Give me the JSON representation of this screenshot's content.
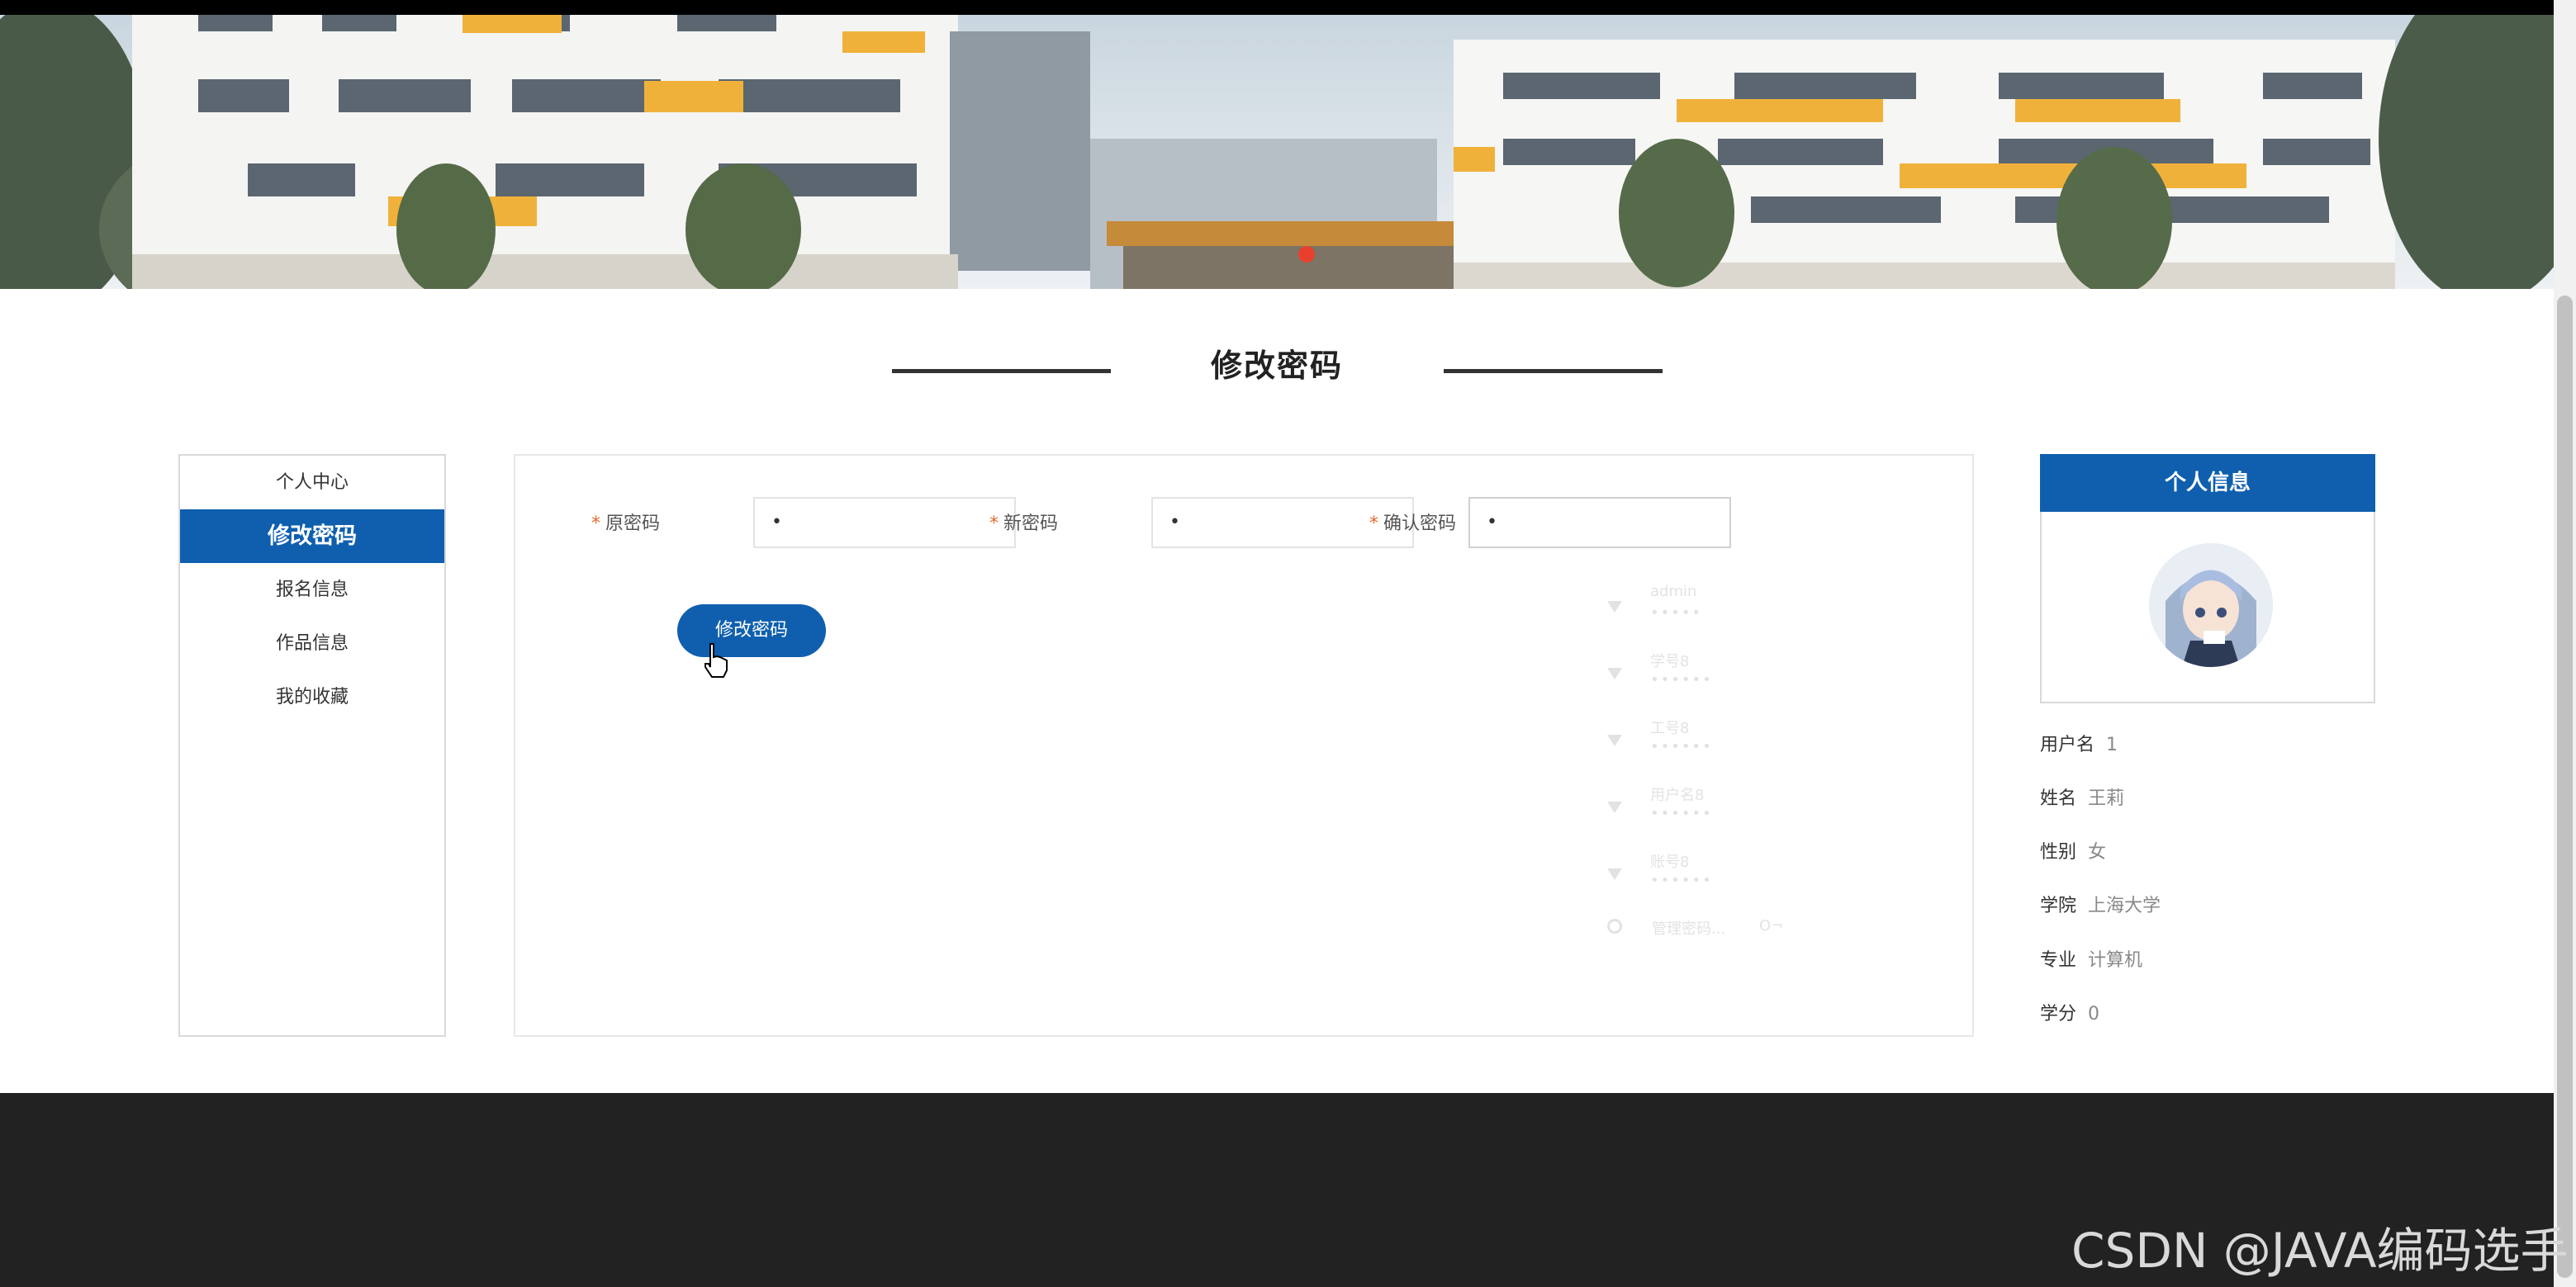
{
  "page": {
    "title": "修改密码"
  },
  "menu": {
    "items": [
      {
        "label": "个人中心",
        "active": false
      },
      {
        "label": "修改密码",
        "active": true
      },
      {
        "label": "报名信息",
        "active": false
      },
      {
        "label": "作品信息",
        "active": false
      },
      {
        "label": "我的收藏",
        "active": false
      }
    ]
  },
  "form": {
    "old_password": {
      "label": "原密码",
      "value": "•"
    },
    "new_password": {
      "label": "新密码",
      "value": "•"
    },
    "confirm_password": {
      "label": "确认密码",
      "value": "•"
    },
    "required_mark": "*",
    "submit_label": "修改密码"
  },
  "autofill": {
    "entries": [
      {
        "name": "admin",
        "mask": "•••••"
      },
      {
        "name": "学号8",
        "mask": "••••••"
      },
      {
        "name": "工号8",
        "mask": "••••••"
      },
      {
        "name": "用户名8",
        "mask": "••••••"
      },
      {
        "name": "账号8",
        "mask": "••••••"
      }
    ],
    "manage_label": "管理密码...",
    "key_glyph": "O¬"
  },
  "profile": {
    "header": "个人信息",
    "fields": [
      {
        "key": "用户名",
        "value": "1"
      },
      {
        "key": "姓名",
        "value": "王莉"
      },
      {
        "key": "性别",
        "value": "女"
      },
      {
        "key": "学院",
        "value": "上海大学"
      },
      {
        "key": "专业",
        "value": "计算机"
      },
      {
        "key": "学分",
        "value": "0"
      }
    ]
  },
  "watermark": "CSDN @JAVA编码选手",
  "colors": {
    "primary": "#0f5fae",
    "required": "#e96a2c",
    "footer": "#232222"
  }
}
